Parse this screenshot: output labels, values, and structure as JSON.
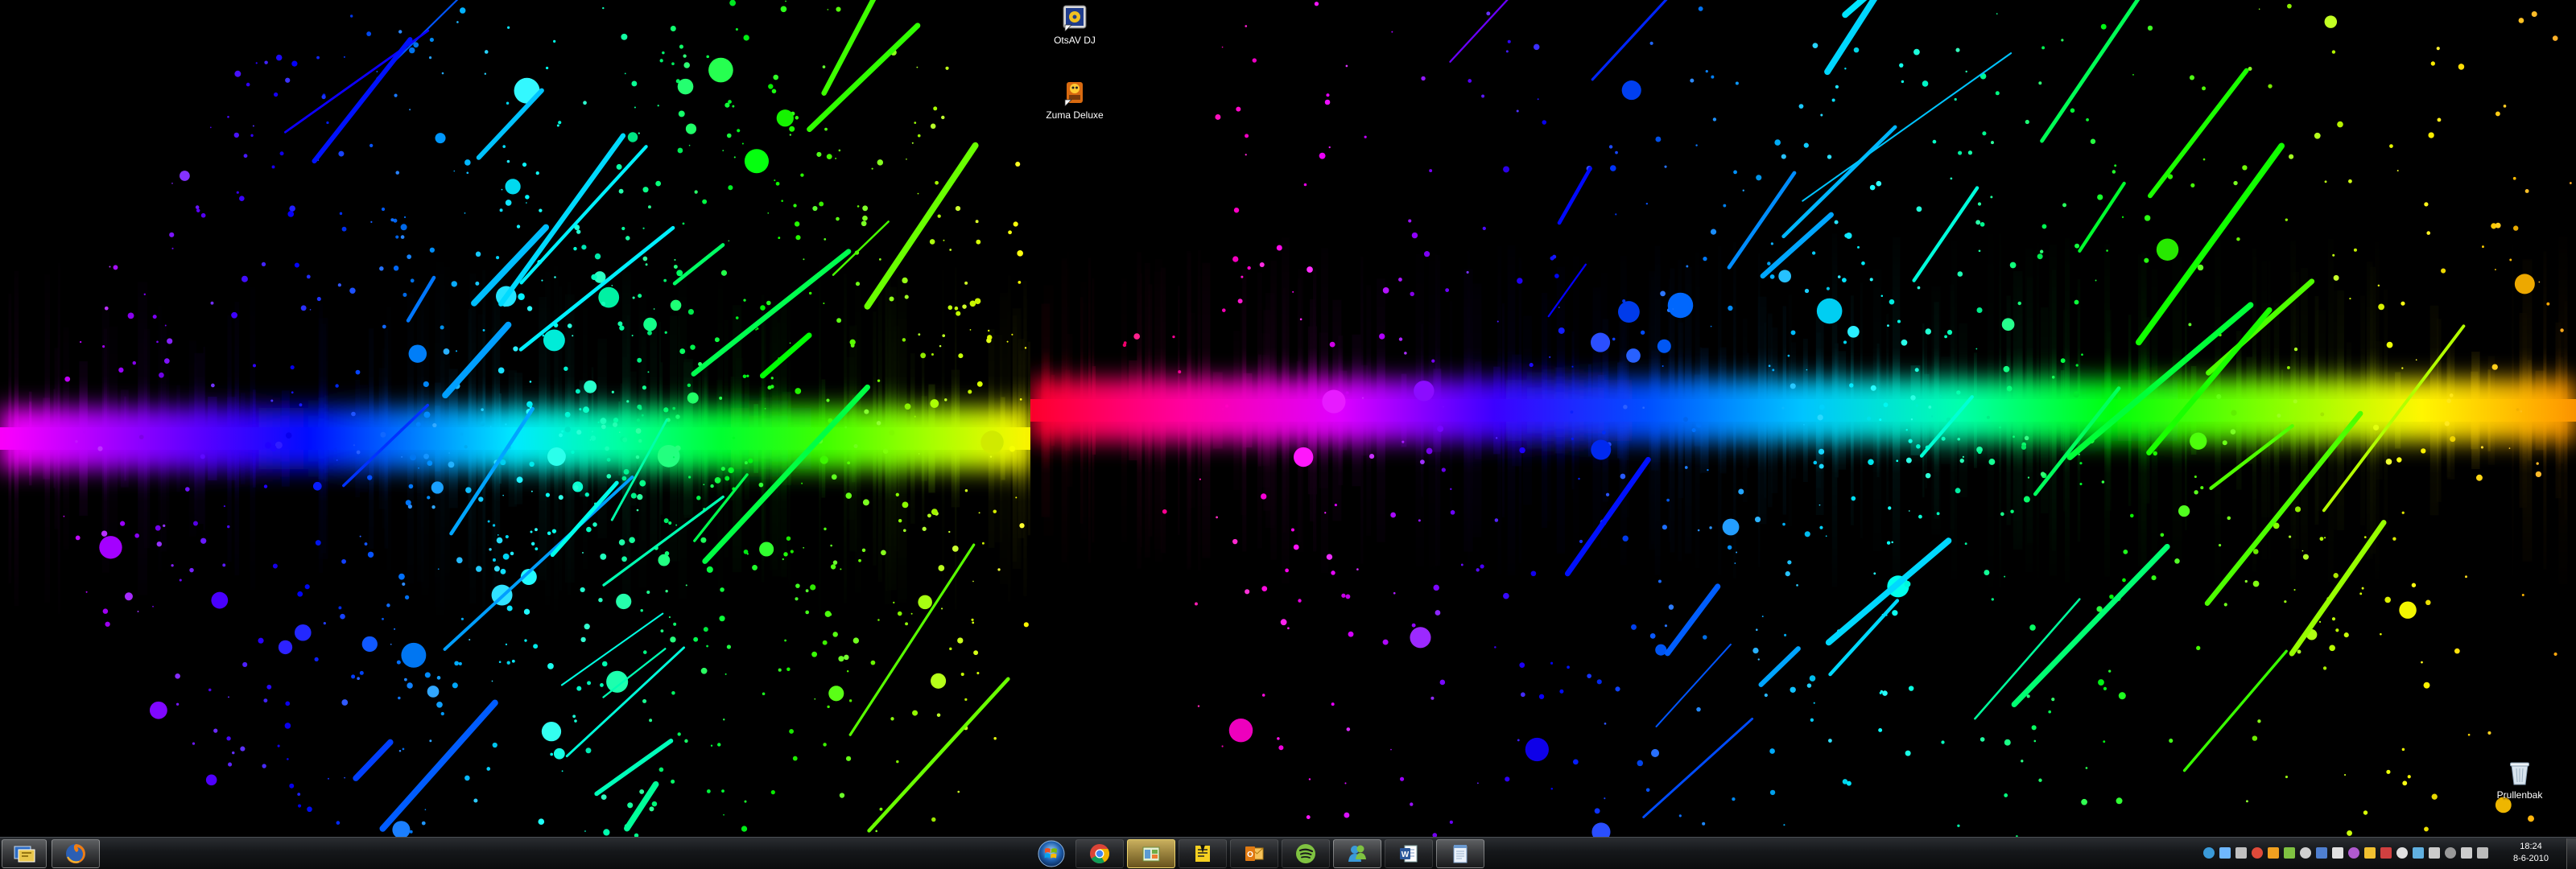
{
  "desktop": {
    "icons": [
      {
        "label": "OtsAV DJ",
        "icon": "otsav-dj-icon"
      },
      {
        "label": "Zuma Deluxe",
        "icon": "zuma-deluxe-icon"
      },
      {
        "label": "Prullenbak",
        "icon": "recycle-bin-icon"
      }
    ],
    "wallpaper": "rainbow paint splatter"
  },
  "taskbar": {
    "left_apps": [
      {
        "name": "desktop-switcher",
        "icon": "desktop-switcher-icon"
      },
      {
        "name": "firefox",
        "icon": "firefox-icon"
      }
    ],
    "center_apps": [
      {
        "name": "start",
        "icon": "windows-start-orb"
      },
      {
        "name": "chrome",
        "icon": "chrome-icon"
      },
      {
        "name": "library",
        "icon": "library-icon"
      },
      {
        "name": "notes",
        "icon": "sticky-notes-icon"
      },
      {
        "name": "outlook",
        "icon": "outlook-icon"
      },
      {
        "name": "spotify",
        "icon": "spotify-icon"
      },
      {
        "name": "messenger",
        "icon": "live-messenger-icon"
      },
      {
        "name": "word",
        "icon": "word-icon"
      },
      {
        "name": "notepad",
        "icon": "notepad-icon"
      }
    ],
    "clock": {
      "time": "18:24",
      "date": "8-6-2010"
    },
    "tray_icon_count": 18
  },
  "colors": {
    "taskbar_top": "#2a2d31",
    "taskbar_bottom": "#0b0c0d",
    "highlight_button": "#e8c64c"
  }
}
